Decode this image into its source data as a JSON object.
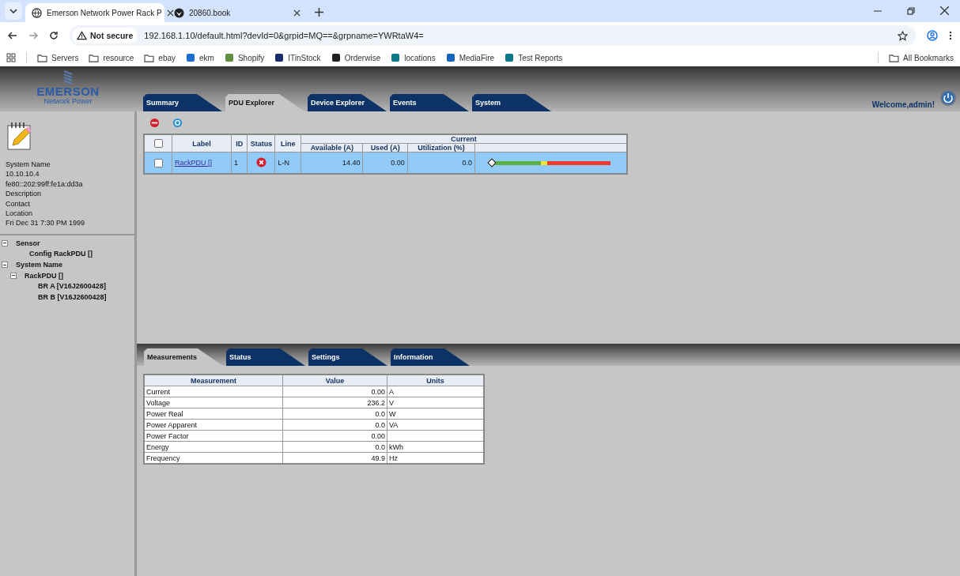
{
  "browser": {
    "tabs": [
      {
        "title": "Emerson Network Power Rack P",
        "selected": true
      },
      {
        "title": "20860.book",
        "selected": false
      }
    ],
    "address": {
      "security": "Not secure",
      "url": "192.168.1.10/default.html?devId=0&grpid=MQ==&grpname=YWRtaW4="
    },
    "bookmarks": [
      "Servers",
      "resource",
      "ebay",
      "ekm",
      "Shopify",
      "ITinStock",
      "Orderwise",
      "locations",
      "MediaFire",
      "Test Reports"
    ],
    "all_bookmarks": "All Bookmarks"
  },
  "header": {
    "logo": {
      "name": "EMERSON",
      "sub": "Network Power"
    },
    "tabs": [
      {
        "label": "Summary",
        "selected": false
      },
      {
        "label": "PDU Explorer",
        "selected": true
      },
      {
        "label": "Device Explorer",
        "selected": false
      },
      {
        "label": "Events",
        "selected": false
      },
      {
        "label": "System",
        "selected": false
      }
    ],
    "welcome": "Welcome,admin!"
  },
  "sidebar": {
    "info": [
      "System Name",
      "10.10.10.4",
      "fe80::202:99ff:fe1a:dd3a",
      "Description",
      "Contact",
      "Location",
      "Fri Dec 31 7:30 PM 1999"
    ],
    "tree": [
      {
        "label": "Sensor",
        "expanded": true,
        "children": [
          {
            "label": "Config RackPDU []"
          }
        ]
      },
      {
        "label": "System Name",
        "expanded": true,
        "children": [
          {
            "label": "RackPDU []",
            "expanded": true,
            "children": [
              {
                "label": "BR A [V16J2600428]"
              },
              {
                "label": "BR B [V16J2600428]"
              }
            ]
          }
        ]
      }
    ]
  },
  "pdu_table": {
    "header_checked": false,
    "columns": [
      "Label",
      "ID",
      "Status",
      "Line"
    ],
    "group": "Current",
    "subcolumns": [
      "Available (A)",
      "Used (A)",
      "Utilization (%)"
    ],
    "rows": [
      {
        "checked": false,
        "selected": true,
        "label": "RackPDU []",
        "id": "1",
        "fault": true,
        "line": "L-N",
        "available": "14.40",
        "used": "0.00",
        "utilization": "0.0",
        "level": 0
      }
    ]
  },
  "detail": {
    "tabs": [
      {
        "label": "Measurements",
        "selected": true
      },
      {
        "label": "Status",
        "selected": false
      },
      {
        "label": "Settings",
        "selected": false
      },
      {
        "label": "Information",
        "selected": false
      }
    ],
    "columns": [
      "Measurement",
      "Value",
      "Units"
    ],
    "rows": [
      [
        "Current",
        "0.00",
        "A"
      ],
      [
        "Voltage",
        "236.2",
        "V"
      ],
      [
        "Power Real",
        "0.0",
        "W"
      ],
      [
        "Power Apparent",
        "0.0",
        "VA"
      ],
      [
        "Power Factor",
        "0.00",
        ""
      ],
      [
        "Energy",
        "0.0",
        "kWh"
      ],
      [
        "Frequency",
        "49.9",
        "Hz"
      ]
    ]
  }
}
